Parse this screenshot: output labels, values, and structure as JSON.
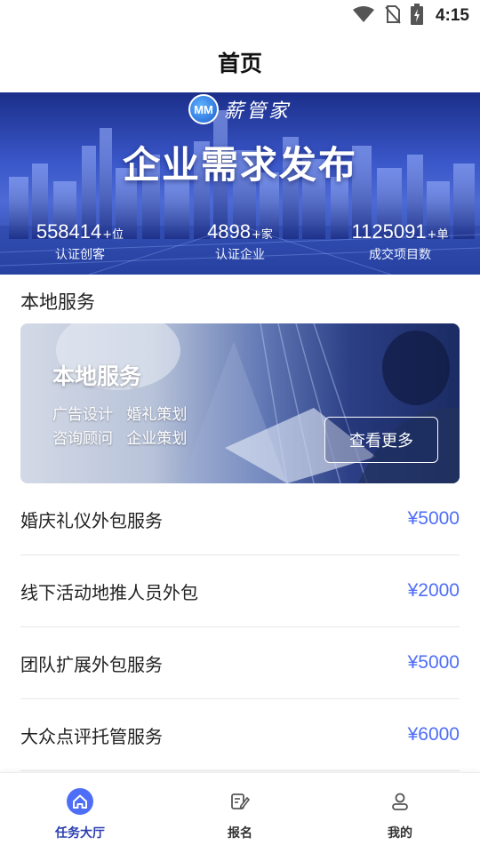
{
  "status_bar": {
    "time": "4:15",
    "icons": [
      "wifi-icon",
      "no-sim-icon",
      "battery-charging-icon"
    ]
  },
  "header": {
    "title": "首页"
  },
  "hero": {
    "logo_mark": "MM",
    "logo_text": "薪管家",
    "headline": "企业需求发布",
    "stats": [
      {
        "value": "558414",
        "unit": "+位",
        "label": "认证创客"
      },
      {
        "value": "4898",
        "unit": "+家",
        "label": "认证企业"
      },
      {
        "value": "1125091",
        "unit": "+单",
        "label": "成交项目数"
      }
    ]
  },
  "local_service": {
    "section_title": "本地服务",
    "card_title": "本地服务",
    "line1": "广告设计 婚礼策划",
    "line2": "咨询顾问 企业策划",
    "more_label": "查看更多"
  },
  "tasks": [
    {
      "name": "婚庆礼仪外包服务",
      "price": "¥5000"
    },
    {
      "name": "线下活动地推人员外包",
      "price": "¥2000"
    },
    {
      "name": "团队扩展外包服务",
      "price": "¥5000"
    },
    {
      "name": "大众点评托管服务",
      "price": "¥6000"
    }
  ],
  "bottom_nav": [
    {
      "label": "任务大厅",
      "icon": "home-icon",
      "active": true
    },
    {
      "label": "报名",
      "icon": "signup-edit-icon",
      "active": false
    },
    {
      "label": "我的",
      "icon": "profile-icon",
      "active": false
    }
  ],
  "colors": {
    "accent": "#4f6ef7",
    "nav_active": "#2a3eb0",
    "hero_blue": "#3a57c9"
  }
}
